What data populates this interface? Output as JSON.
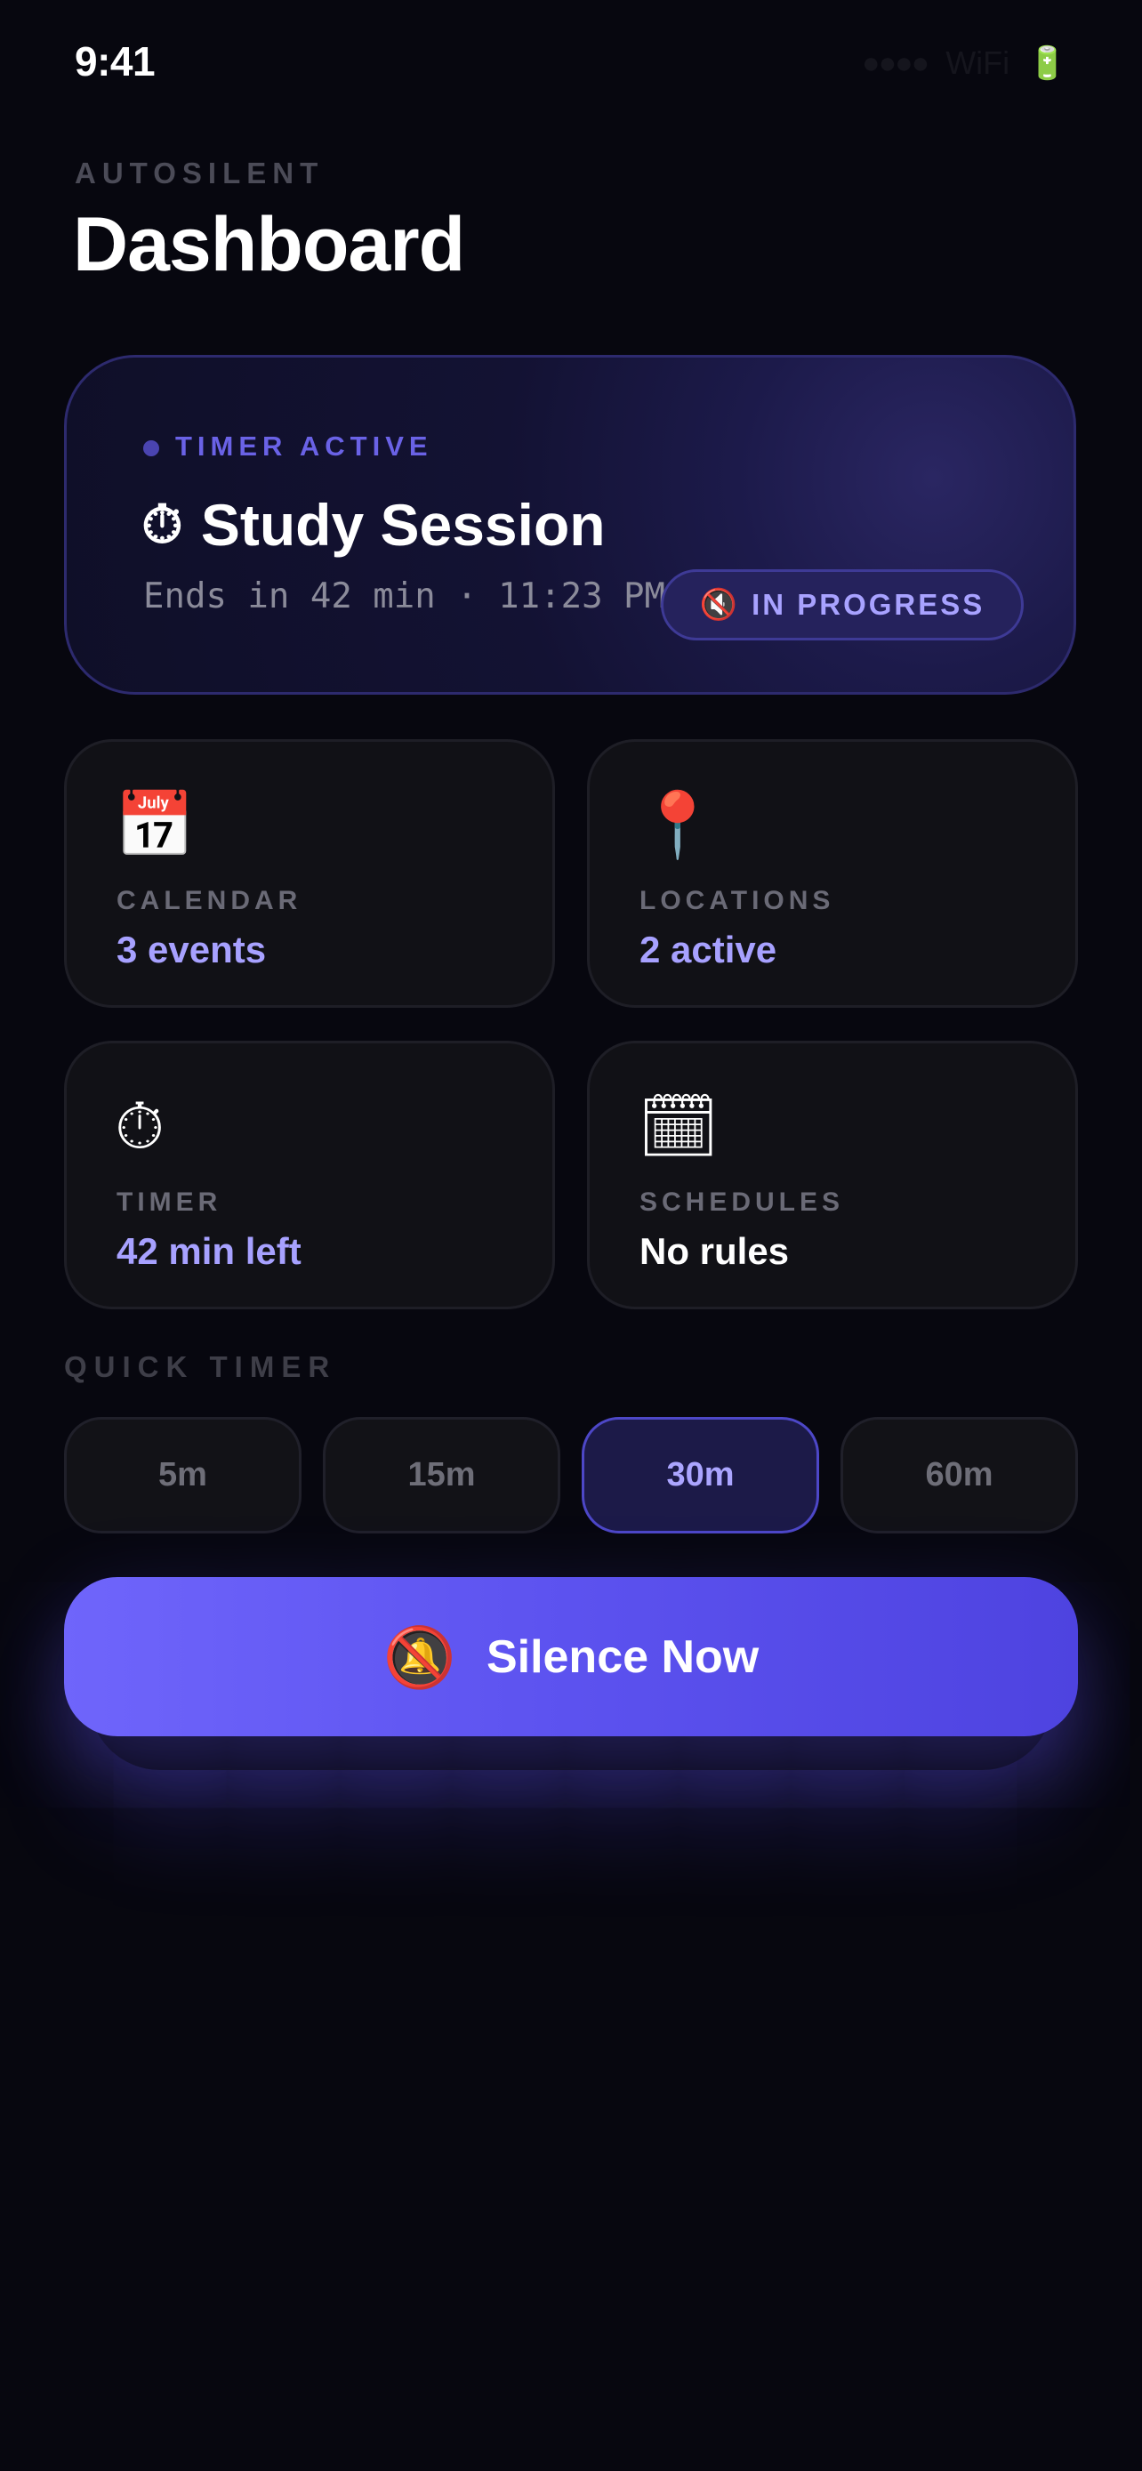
{
  "status_bar": {
    "time": "9:41",
    "signal": "●●●●",
    "wifi": "WiFi",
    "battery_icon": "battery-icon"
  },
  "header": {
    "eyebrow": "AUTOSILENT",
    "title": "Dashboard"
  },
  "hero": {
    "label": "TIMER ACTIVE",
    "title_icon": "⏱",
    "title": "Study Session",
    "subtitle": "Ends in 42 min · 11:23 PM",
    "badge_icon": "🔇",
    "badge_text": "IN PROGRESS",
    "accent_color": "#6a62e6"
  },
  "cards": [
    {
      "icon": "📅",
      "icon_name": "calendar-icon",
      "label": "CALENDAR",
      "value": "3 events",
      "accent": true
    },
    {
      "icon": "📍",
      "icon_name": "location-pin-icon",
      "label": "LOCATIONS",
      "value": "2 active",
      "accent": true
    },
    {
      "icon": "⏱",
      "icon_name": "stopwatch-icon",
      "label": "TIMER",
      "value": "42 min left",
      "accent": true
    },
    {
      "icon": "🗓",
      "icon_name": "schedule-calendar-icon",
      "label": "SCHEDULES",
      "value": "No rules",
      "accent": false
    }
  ],
  "quick_timer": {
    "label": "QUICK TIMER",
    "options": [
      "5m",
      "15m",
      "30m",
      "60m"
    ],
    "selected": "30m"
  },
  "silence_button": {
    "icon": "🔕",
    "label": "Silence Now",
    "color": "#5c52ef"
  }
}
